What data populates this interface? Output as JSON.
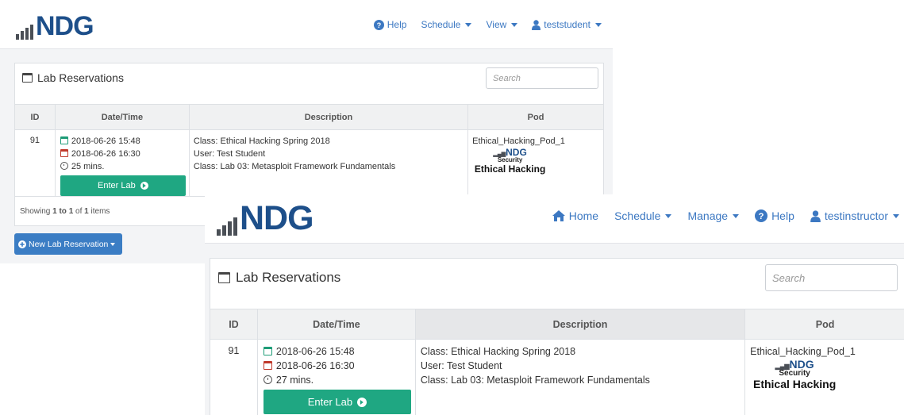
{
  "back": {
    "logo": "NDG",
    "nav": {
      "help": "Help",
      "schedule": "Schedule",
      "view": "View",
      "user": "teststudent"
    },
    "card_title": "Lab Reservations",
    "search_placeholder": "Search",
    "columns": [
      "ID",
      "Date/Time",
      "Description",
      "Pod"
    ],
    "row": {
      "id": "91",
      "start": "2018-06-26 15:48",
      "end": "2018-06-26 16:30",
      "duration": "25 mins.",
      "enter_label": "Enter Lab",
      "class_line": "Class: Ethical Hacking Spring 2018",
      "user_line": "User: Test Student",
      "lab_line": "Class: Lab 03: Metasploit Framework Fundamentals",
      "pod_name": "Ethical_Hacking_Pod_1",
      "pod_logo": "NDG",
      "pod_security": "Security",
      "pod_course": "Ethical Hacking"
    },
    "footer": {
      "showing": "Showing",
      "range": "1 to 1",
      "of": "of",
      "total": "1",
      "items": "items"
    },
    "new_button": "New Lab Reservation"
  },
  "front": {
    "logo": "NDG",
    "nav": {
      "home": "Home",
      "schedule": "Schedule",
      "manage": "Manage",
      "help": "Help",
      "user": "testinstructor"
    },
    "card_title": "Lab Reservations",
    "search_placeholder": "Search",
    "columns": [
      "ID",
      "Date/Time",
      "Description",
      "Pod"
    ],
    "row": {
      "id": "91",
      "start": "2018-06-26 15:48",
      "end": "2018-06-26 16:30",
      "duration": "27 mins.",
      "enter_label": "Enter Lab",
      "class_line": "Class: Ethical Hacking Spring 2018",
      "user_line": "User: Test Student",
      "lab_line": "Class: Lab 03: Metasploit Framework Fundamentals",
      "pod_name": "Ethical_Hacking_Pod_1",
      "pod_logo": "NDG",
      "pod_security": "Security",
      "pod_course": "Ethical Hacking"
    }
  },
  "colors": {
    "accent": "#3c78c2",
    "brand": "#1d4f8a",
    "enter_button": "#1fa782",
    "new_button": "#3b7dc4"
  }
}
